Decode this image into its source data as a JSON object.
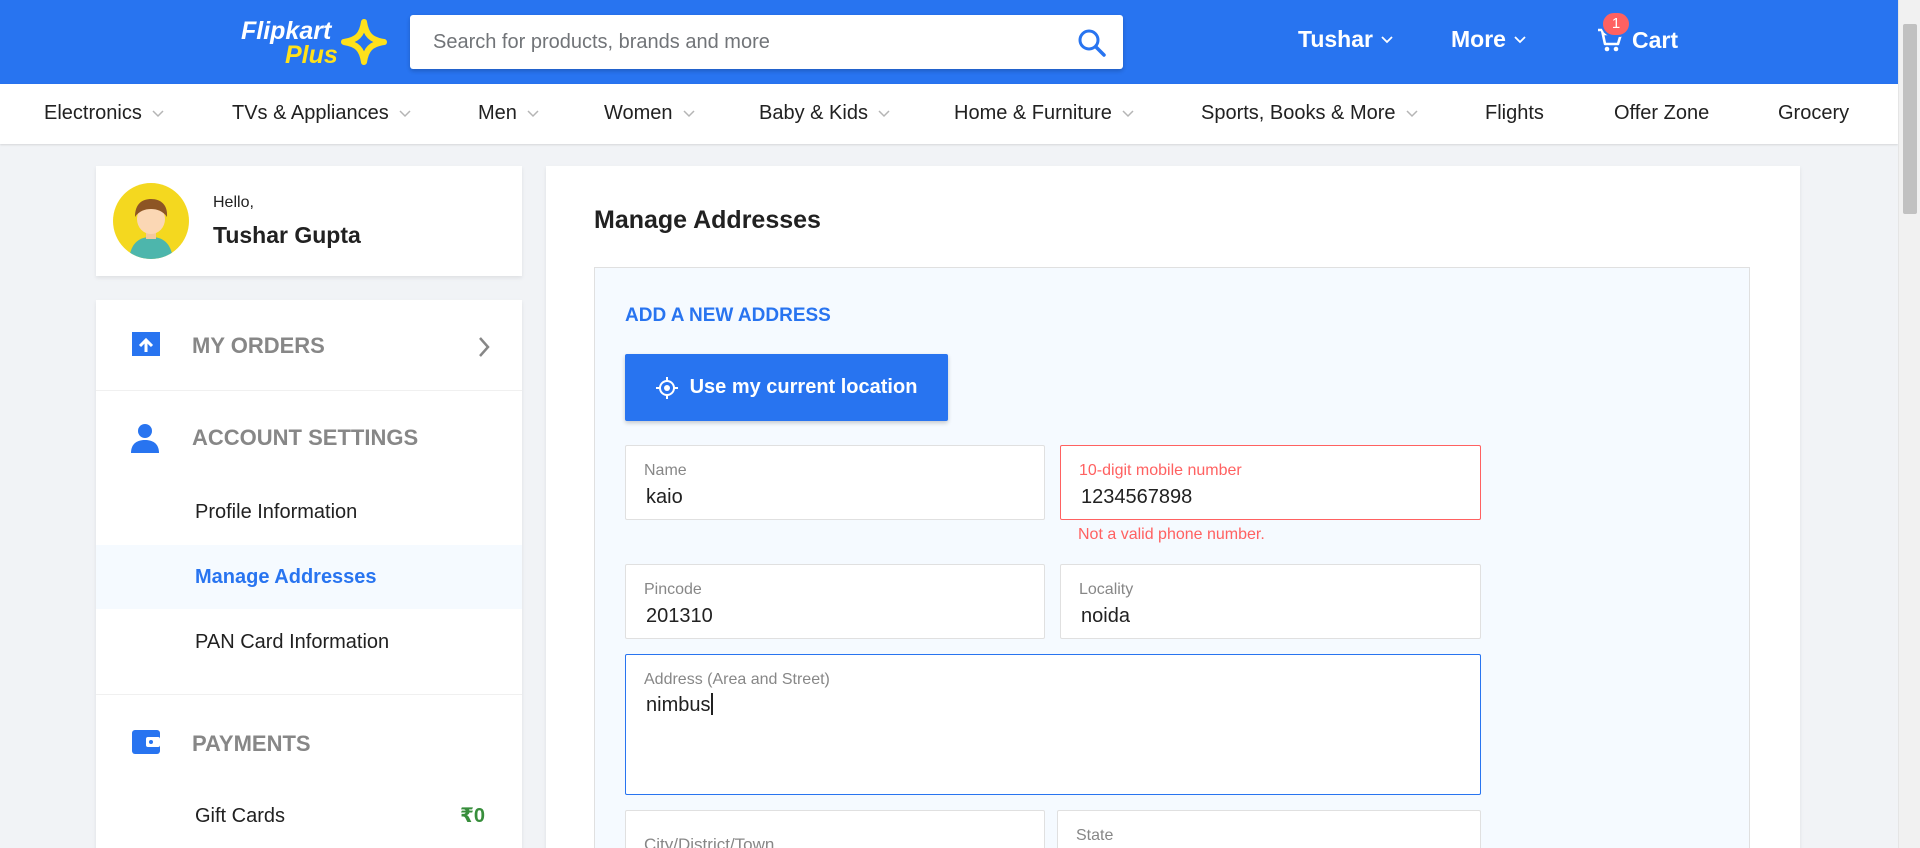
{
  "header": {
    "logo_top": "Flipkart",
    "logo_bottom": "Plus",
    "search_placeholder": "Search for products, brands and more",
    "user": "Tushar",
    "more": "More",
    "cart_label": "Cart",
    "cart_count": "1",
    "brand_color": "#2874f0",
    "logo_accent": "#ffe11b"
  },
  "categories": [
    {
      "label": "Electronics",
      "dropdown": true
    },
    {
      "label": "TVs & Appliances",
      "dropdown": true
    },
    {
      "label": "Men",
      "dropdown": true
    },
    {
      "label": "Women",
      "dropdown": true
    },
    {
      "label": "Baby & Kids",
      "dropdown": true
    },
    {
      "label": "Home & Furniture",
      "dropdown": true
    },
    {
      "label": "Sports, Books & More",
      "dropdown": true
    },
    {
      "label": "Flights",
      "dropdown": false
    },
    {
      "label": "Offer Zone",
      "dropdown": false
    },
    {
      "label": "Grocery",
      "dropdown": false
    }
  ],
  "profile": {
    "greeting": "Hello,",
    "name": "Tushar Gupta"
  },
  "sidebar": {
    "my_orders": "MY ORDERS",
    "account_settings": "ACCOUNT SETTINGS",
    "account_items": [
      "Profile Information",
      "Manage Addresses",
      "PAN Card Information"
    ],
    "active_item": "Manage Addresses",
    "payments": "PAYMENTS",
    "gift_cards": "Gift Cards",
    "gift_cards_value": "₹0"
  },
  "main": {
    "title": "Manage Addresses",
    "add_new_label": "ADD A NEW ADDRESS",
    "use_location_button": "Use my current location",
    "fields": {
      "name": {
        "label": "Name",
        "value": "kaio"
      },
      "mobile": {
        "label": "10-digit mobile number",
        "value": "1234567898",
        "error": "Not a valid phone number."
      },
      "pincode": {
        "label": "Pincode",
        "value": "201310"
      },
      "locality": {
        "label": "Locality",
        "value": "noida"
      },
      "address": {
        "label": "Address (Area and Street)",
        "value": "nimbus"
      },
      "city": {
        "label": "City/District/Town",
        "value": ""
      },
      "state": {
        "label": "State",
        "value": ""
      }
    },
    "error_color": "#ff6161"
  }
}
